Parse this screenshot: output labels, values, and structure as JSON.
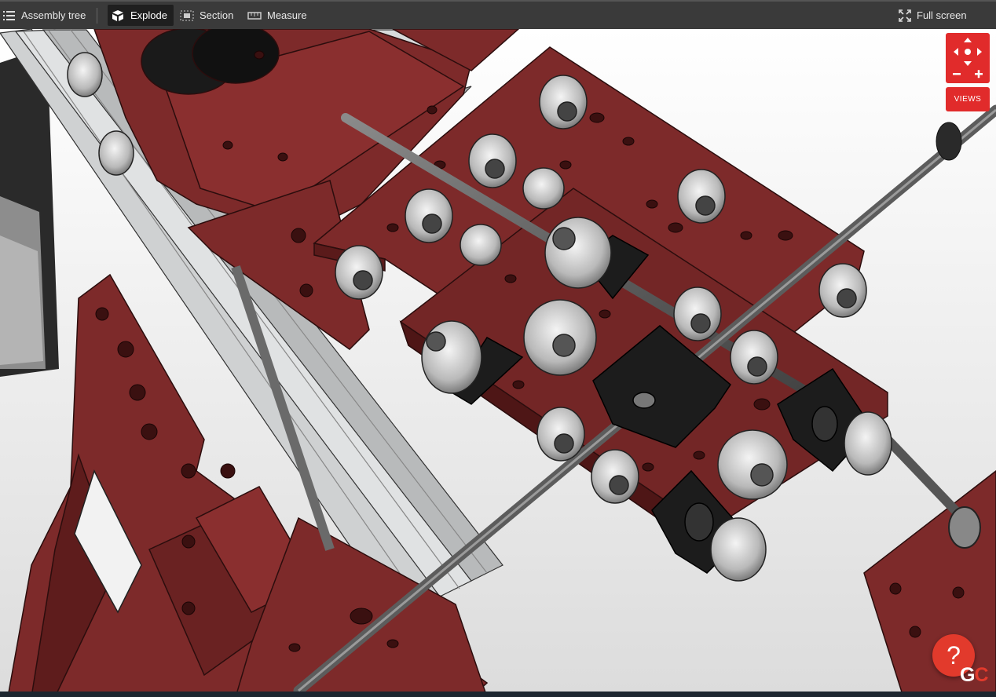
{
  "toolbar": {
    "assembly_tree": "Assembly tree",
    "explode": "Explode",
    "section": "Section",
    "measure": "Measure",
    "fullscreen": "Full screen"
  },
  "viewer": {
    "views_label": "VIEWS",
    "help_symbol": "?",
    "logo_g": "G",
    "logo_c": "C"
  },
  "colors": {
    "toolbar_bg": "#3a3a3a",
    "accent_red": "#e12b2b",
    "plate_red": "#7d2a2a",
    "plate_edge": "#5a1a1a",
    "rail_silver": "#c9cbcc",
    "bracket_black": "#1c1c1c"
  },
  "icons": [
    "list-icon",
    "explode-icon",
    "section-icon",
    "ruler-icon",
    "fullscreen-icon",
    "pan-arrows-icon",
    "zoom-minus-icon",
    "zoom-plus-icon",
    "help-icon"
  ]
}
